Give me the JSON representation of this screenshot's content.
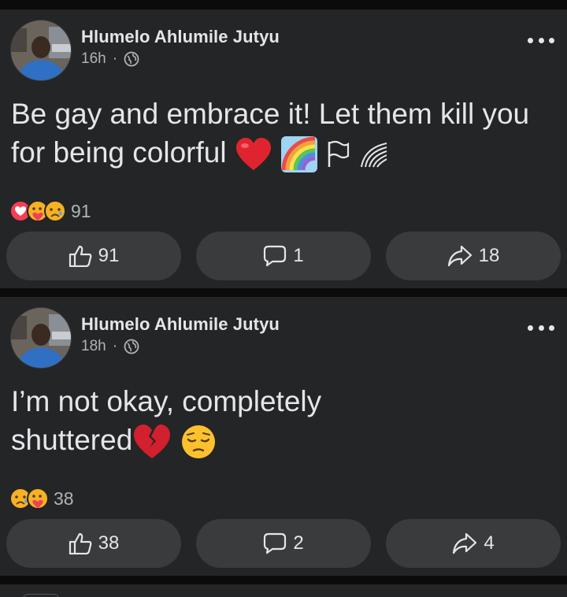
{
  "posts": [
    {
      "author": "Hlumelo Ahlumile Jutyu",
      "time": "16h",
      "separator": "·",
      "text": "Be gay and embrace it! Let them kill you for being colorful",
      "emojis": [
        "red-heart",
        "rainbow",
        "flag",
        "wave"
      ],
      "reactions": {
        "types": [
          "love",
          "care",
          "sad"
        ],
        "count": "91"
      },
      "actions": {
        "like": "91",
        "comment": "1",
        "share": "18"
      }
    },
    {
      "author": "Hlumelo Ahlumile Jutyu",
      "time": "18h",
      "separator": "·",
      "text": "I’m not okay, completely shuttered",
      "emojis": [
        "broken-heart",
        "pensive-face"
      ],
      "reactions": {
        "types": [
          "sad",
          "care"
        ],
        "count": "38"
      },
      "actions": {
        "like": "38",
        "comment": "2",
        "share": "4"
      }
    }
  ],
  "colors": {
    "background": "#0b0b0c",
    "card": "#242526",
    "button": "#3a3b3c",
    "text": "#e4e6eb",
    "secondary": "#b0b3b8"
  }
}
